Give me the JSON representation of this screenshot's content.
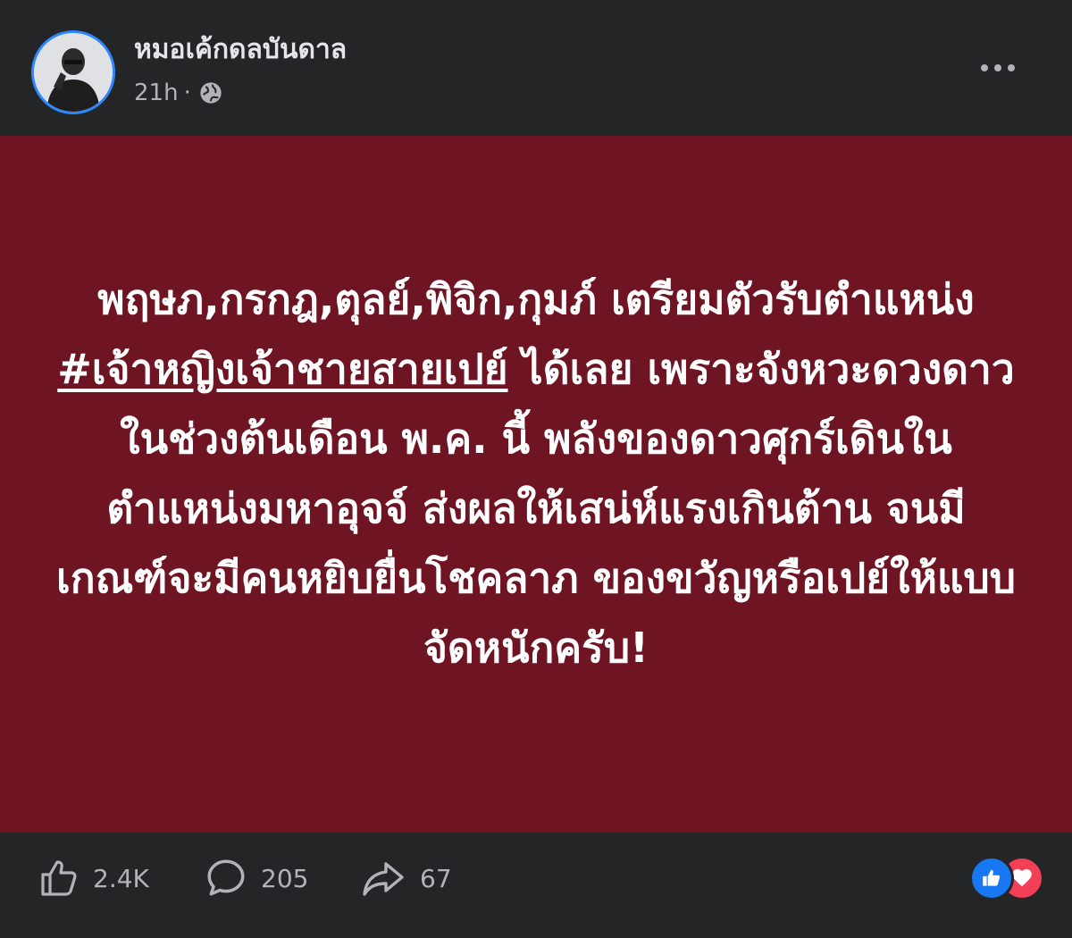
{
  "post": {
    "author": "หมอเค้กดลบันดาล",
    "timestamp": "21h",
    "separator": "·",
    "privacy_icon": "globe-icon",
    "menu_icon": "more-options-icon",
    "background_color": "#6e1423",
    "text_segments": [
      "พฤษภ,กรกฎ,ตุลย์,พิจิก,กุมภ์ เตรียมตัวรับตำแหน่ง ",
      "#เจ้าหญิงเจ้าชายสายเปย์",
      " ได้เลย เพราะจังหวะดวงดาวในช่วงต้นเดือน พ.ค. นี้ พลังของดาวศุกร์เดินในตำแหน่งมหาอุจจ์ ส่งผลให้เสน่ห์แรงเกินต้าน จนมีเกณฑ์จะมีคนหยิบยื่นโชคลาภ ของขวัญหรือเปย์ให้แบบจัดหนักครับ!"
    ]
  },
  "stats": {
    "likes": "2.4K",
    "comments": "205",
    "shares": "67",
    "like_icon": "thumbs-up-icon",
    "comment_icon": "comment-bubble-icon",
    "share_icon": "share-arrow-icon",
    "reactions": [
      "like",
      "love"
    ],
    "like_color": "#1877f2",
    "love_color": "#f33e58"
  }
}
